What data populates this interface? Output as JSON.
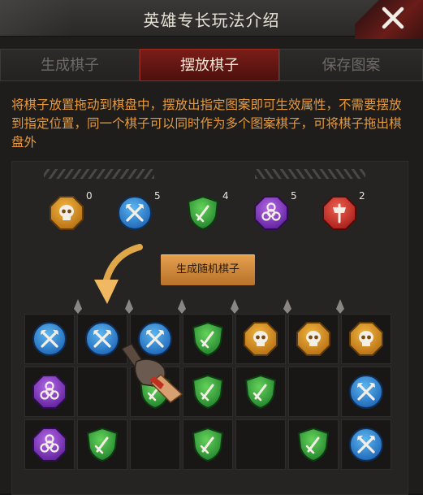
{
  "header": {
    "title": "英雄专长玩法介绍"
  },
  "tabs": [
    {
      "label": "生成棋子",
      "active": false
    },
    {
      "label": "摆放棋子",
      "active": true
    },
    {
      "label": "保存图案",
      "active": false
    }
  ],
  "instructions": "将棋子放置拖动到棋盘中，摆放出指定图案即可生效属性，不需要摆放到指定位置，同一个棋子可以同时作为多个图案棋子，可将棋子拖出棋盘外",
  "inventory": [
    {
      "type": "skull",
      "count": "0"
    },
    {
      "type": "axe",
      "count": "5"
    },
    {
      "type": "sword",
      "count": "4"
    },
    {
      "type": "biohazard",
      "count": "5"
    },
    {
      "type": "warhammer",
      "count": "2"
    }
  ],
  "generate_button": "生成随机棋子",
  "board": [
    [
      "axe",
      "axe",
      "axe",
      "sword",
      "skull",
      "skull",
      "skull"
    ],
    [
      "biohazard",
      "",
      "sword",
      "sword",
      "sword",
      "",
      "axe"
    ],
    [
      "biohazard",
      "sword",
      "",
      "sword",
      "",
      "sword",
      "axe"
    ]
  ],
  "colors": {
    "accent_orange": "#e69a3c",
    "tab_active": "#7a1d18",
    "button": "#d48c3c"
  }
}
